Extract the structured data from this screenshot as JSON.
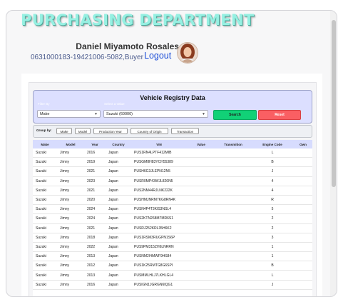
{
  "header": {
    "title": "PURCHASING DEPARTMENT",
    "user_name": "Daniel Miyamoto Rosales",
    "user_meta": "0631000183-19421006-5082,Buyer",
    "logout_label": "Logout"
  },
  "registry": {
    "title": "Vehicle Registry Data",
    "filter_by_label": "Filter By",
    "filter_value_label": "Select a Value",
    "filter_field": "Make",
    "filter_value": "Suzuki (60000)",
    "search_label": "Search",
    "reset_label": "Reset"
  },
  "group_by": {
    "label": "Group by:",
    "buttons": [
      "Make",
      "Model",
      "Production Year",
      "Country of Origin",
      "Transaction"
    ]
  },
  "table": {
    "columns": [
      "Make",
      "Model",
      "Year",
      "Country",
      "VIN",
      "Value",
      "Transmition",
      "Engine Code",
      "Own"
    ],
    "rows": [
      [
        "Suzuki",
        "Jimny",
        "2016",
        "Japan",
        "PUS1RN4LPTF412MIB",
        "",
        "",
        "L"
      ],
      [
        "Suzuki",
        "Jimny",
        "2019",
        "Japan",
        "PUSGM8H83YCH55389",
        "",
        "",
        "B"
      ],
      [
        "Suzuki",
        "Jimny",
        "2021",
        "Japan",
        "PUSH6G3JLEPN12N5",
        "",
        "",
        "J"
      ],
      [
        "Suzuki",
        "Jimny",
        "2023",
        "Japan",
        "PUSR0MP43WJL826N5",
        "",
        "",
        "4"
      ],
      [
        "Suzuki",
        "Jimny",
        "2021",
        "Japan",
        "PUS2NM44RJLNK222K",
        "",
        "",
        "4"
      ],
      [
        "Suzuki",
        "Jimny",
        "2020",
        "Japan",
        "PUSHMJNRM7KG8RN4K",
        "",
        "",
        "R"
      ],
      [
        "Suzuki",
        "Jimny",
        "2024",
        "Japan",
        "PUSN4P4T3KIS3NSL4",
        "",
        "",
        "5"
      ],
      [
        "Suzuki",
        "Jimny",
        "2024",
        "Japan",
        "PUS2KTN268M7MR6S1",
        "",
        "",
        "2"
      ],
      [
        "Suzuki",
        "Jimny",
        "2021",
        "Japan",
        "PUSRJ252KRL35H6K2",
        "",
        "",
        "2"
      ],
      [
        "Suzuki",
        "Jimny",
        "2018",
        "Japan",
        "PUS1RSM3RUGPN1S6P",
        "",
        "",
        "3"
      ],
      [
        "Suzuki",
        "Jimny",
        "2022",
        "Japan",
        "PUS9PM315ZH6LNRRN",
        "",
        "",
        "1"
      ],
      [
        "Suzuki",
        "Jimny",
        "2013",
        "Japan",
        "PUSNM2I4MWF9HS84",
        "",
        "",
        "1"
      ],
      [
        "Suzuki",
        "Jimny",
        "2012",
        "Japan",
        "PUS1K25RMTG8G6SPI",
        "",
        "",
        "B"
      ],
      [
        "Suzuki",
        "Jimny",
        "2013",
        "Japan",
        "PUSMMLHLJ7LKHLGL4",
        "",
        "",
        "L"
      ],
      [
        "Suzuki",
        "Jimny",
        "2016",
        "Japan",
        "PUSIGN1JGRGN6IQG1",
        "",
        "",
        "J"
      ]
    ]
  }
}
